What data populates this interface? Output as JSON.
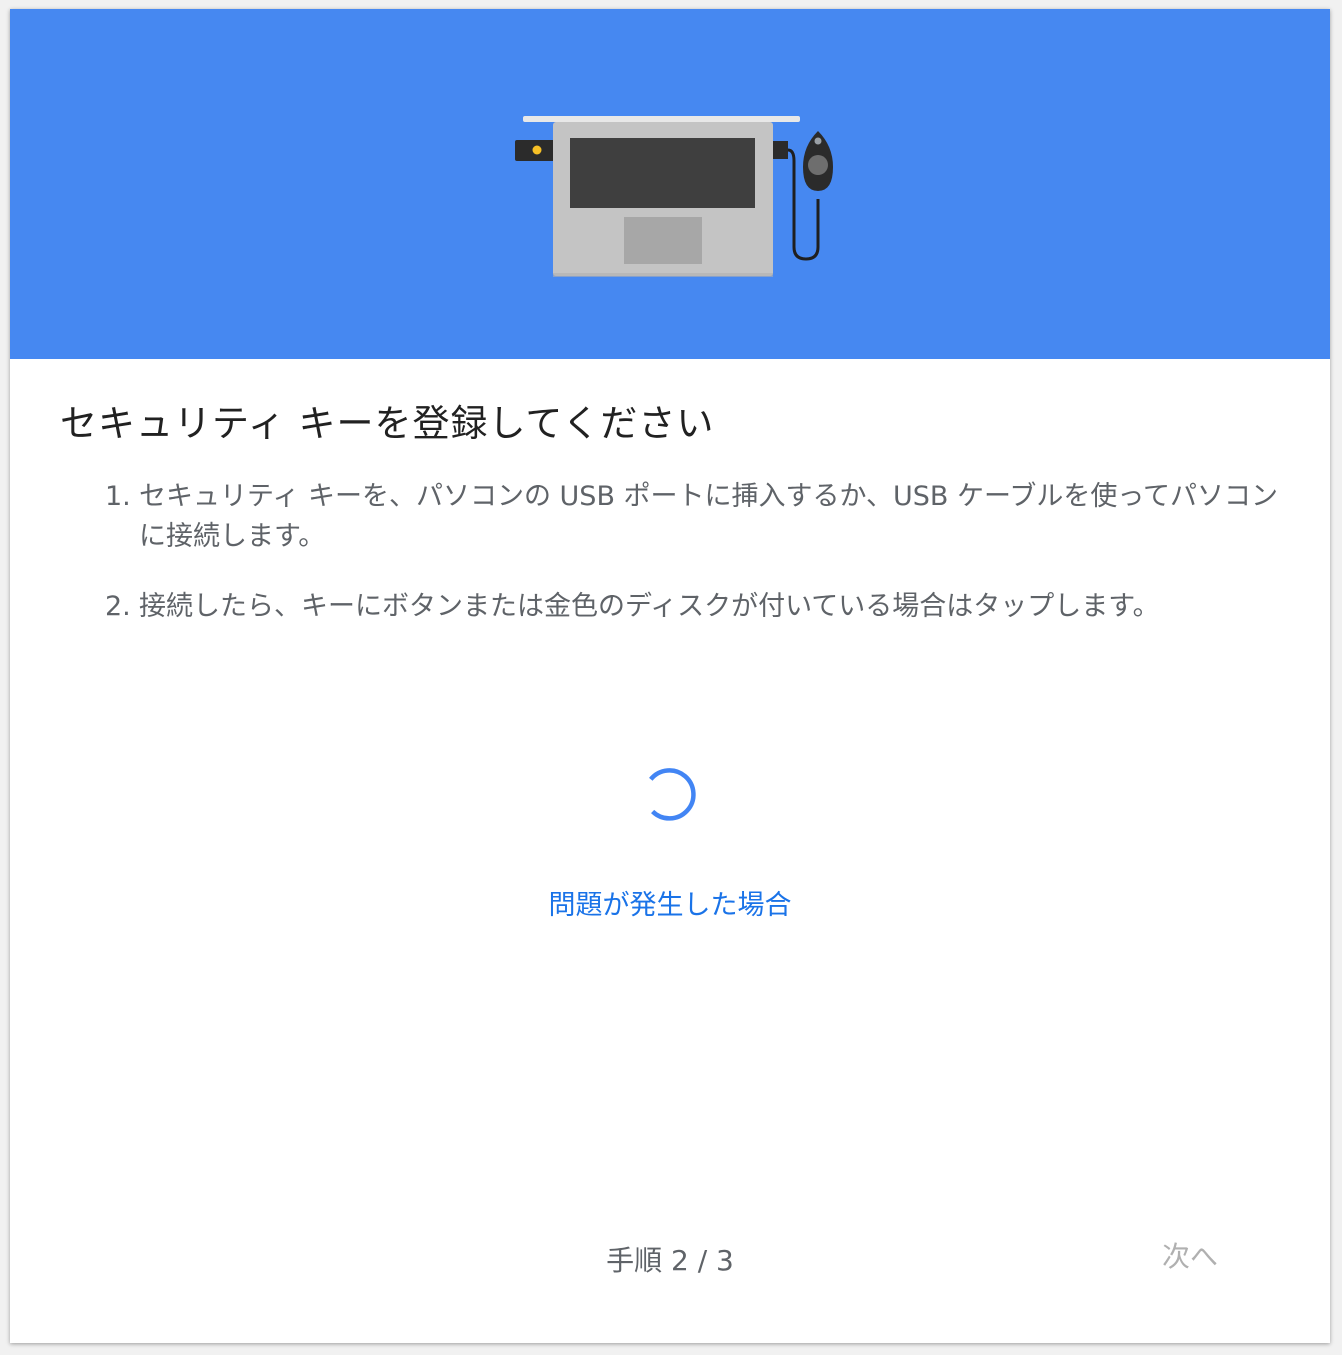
{
  "dialog": {
    "title": "セキュリティ キーを登録してください",
    "steps": [
      {
        "number": "1.",
        "text": "セキュリティ キーを、パソコンの USB ポートに挿入するか、USB ケーブルを使ってパソコンに接続します。"
      },
      {
        "number": "2.",
        "text": "接続したら、キーにボタンまたは金色のディスクが付いている場合はタップします。"
      }
    ],
    "help_link": "問題が発生した場合",
    "step_indicator": "手順 2 / 3",
    "next_label": "次へ"
  },
  "colors": {
    "hero_background": "#4688f1",
    "link": "#1a73e8",
    "spinner": "#4285f4",
    "disabled_text": "#b0b0b0"
  },
  "icons": {
    "illustration": "laptop-with-security-keys-illustration",
    "spinner": "loading-spinner-icon"
  }
}
